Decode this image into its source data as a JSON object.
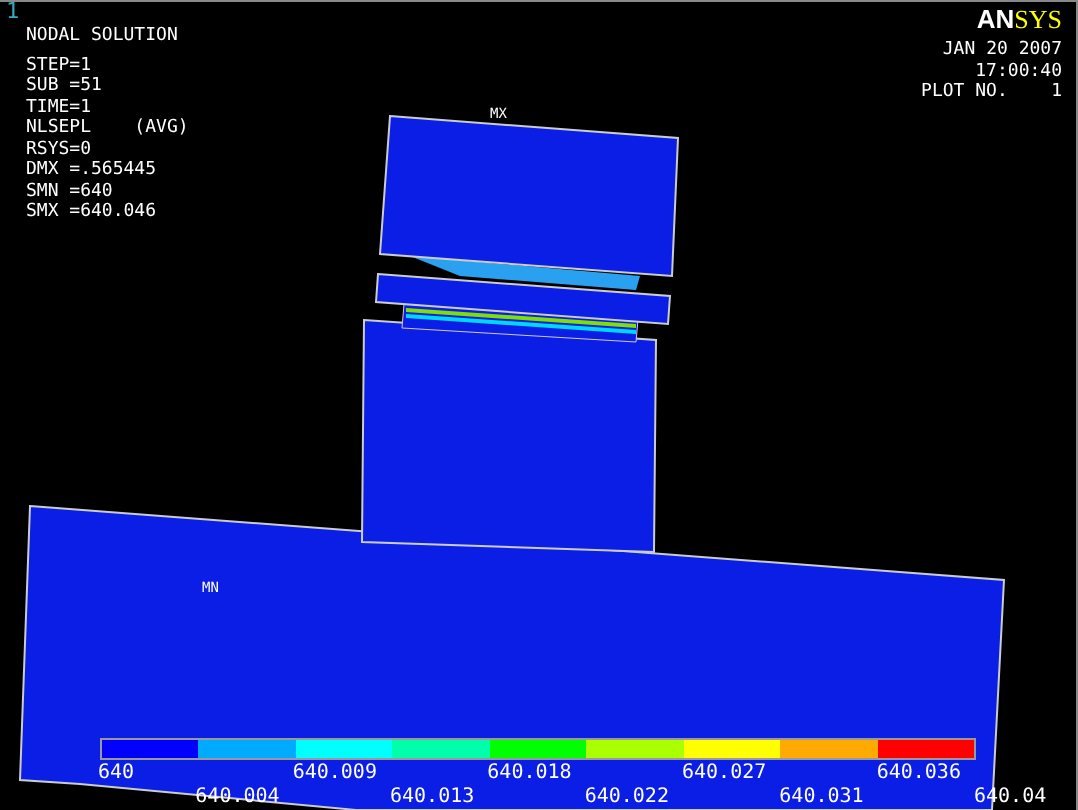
{
  "viewport": {
    "number": "1",
    "title": "NODAL SOLUTION",
    "info_lines": [
      "STEP=1",
      "SUB =51",
      "TIME=1",
      "NLSEPL    (AVG)",
      "RSYS=0",
      "DMX =.565445",
      "SMN =640",
      "SMX =640.046"
    ],
    "logo": {
      "part_1": "AN",
      "part_2": "SYS"
    },
    "date": "JAN 20 2007",
    "time": "17:00:40",
    "plot_number": "PLOT NO.    1",
    "max_label": "MX",
    "min_label": "MN"
  },
  "legend": {
    "bands": [
      {
        "color": "#0000ff"
      },
      {
        "color": "#00aaff"
      },
      {
        "color": "#00ffff"
      },
      {
        "color": "#00ffaa"
      },
      {
        "color": "#00ff00"
      },
      {
        "color": "#aaff00"
      },
      {
        "color": "#ffff00"
      },
      {
        "color": "#ffaa00"
      },
      {
        "color": "#ff0000"
      }
    ],
    "labels": [
      "640",
      "640.004",
      "640.009",
      "640.013",
      "640.018",
      "640.022",
      "640.027",
      "640.031",
      "640.036",
      "640.04"
    ]
  }
}
